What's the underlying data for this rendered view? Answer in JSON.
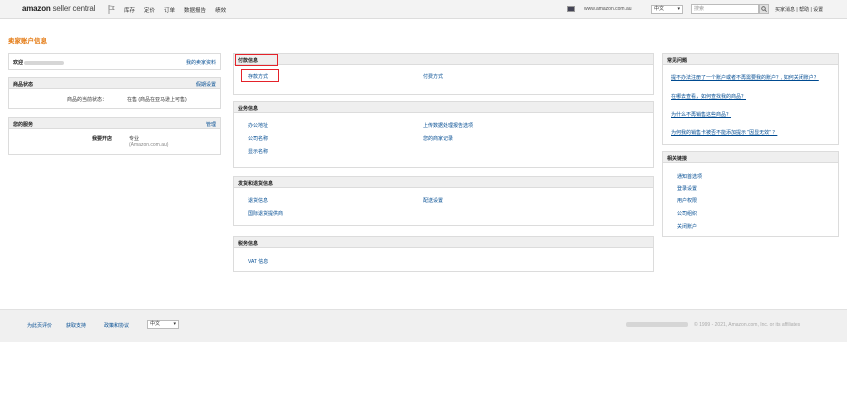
{
  "topbar": {
    "logo_main": "amazon",
    "logo_sub": " seller central",
    "nav": [
      "库存",
      "定价",
      "订单",
      "数据报告",
      "绩效"
    ],
    "domain": "www.amazon.com.au",
    "language": "中文",
    "search_placeholder": "搜索",
    "right_links": "买家消息 | 帮助 | 设置"
  },
  "page": {
    "title": "卖家账户信息"
  },
  "left": {
    "greeting_label": "欢迎",
    "greeting_link": "我的卖家资料",
    "listing_status": {
      "title": "商品状态",
      "link": "假期设置",
      "label": "商品的当前状态：",
      "value": "在售 (商品在亚马逊上可售)"
    },
    "services": {
      "title": "您的服务",
      "link": "管理",
      "label": "我要开店",
      "value": "专业",
      "sub": "(Amazon.com.au)"
    }
  },
  "middle": {
    "payment": {
      "title": "付款信息",
      "left_link": "存款方式",
      "right_link": "付费方式"
    },
    "business": {
      "title": "业务信息",
      "left": [
        "办公地址",
        "公司名称",
        "显示名称"
      ],
      "right": [
        "上传数据处理报告选项",
        "您的商家记录"
      ]
    },
    "shipping": {
      "title": "发货和退货信息",
      "left": [
        "退货信息",
        "国际退货提供商"
      ],
      "right": [
        "配送设置"
      ]
    },
    "tax": {
      "title": "税务信息",
      "left": [
        "VAT 信息"
      ]
    }
  },
  "right": {
    "faq": {
      "title": "常见问题",
      "items": [
        "提不办法注册了一个账户或者不再需要我的账户？, 如何关闭账户？",
        "在哪去查看，如何查找我的商品？",
        "为什么不再销售这些商品？",
        "为何我的销售卡被否不能添加提示 \"因显无效\" ？"
      ]
    },
    "related": {
      "title": "相关链接",
      "items": [
        "通知首选项",
        "登录设置",
        "用户权限",
        "公司组织",
        "关闭账户"
      ]
    }
  },
  "footer": {
    "links": [
      "为此页评价",
      "获取支持",
      "政策和协议"
    ],
    "language": "中文",
    "copyright": "© 1999 - 2021, Amazon.com, Inc. or its affiliates"
  }
}
